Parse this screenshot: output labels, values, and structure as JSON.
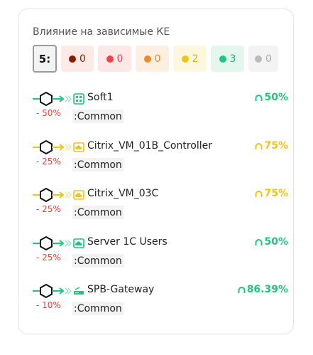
{
  "title": "Влияние на зависимые КЕ",
  "filters": {
    "total": "5:",
    "chips": [
      {
        "count": "0",
        "dot": "#8b1a00",
        "bg": "#fbeae6",
        "fg": "#8b1a00"
      },
      {
        "count": "0",
        "dot": "#ef4444",
        "bg": "#fde8e8",
        "fg": "#ef4444"
      },
      {
        "count": "0",
        "dot": "#f08a24",
        "bg": "#fdefe2",
        "fg": "#f08a24"
      },
      {
        "count": "2",
        "dot": "#f2c318",
        "bg": "#fdf7df",
        "fg": "#e0b100"
      },
      {
        "count": "3",
        "dot": "#22c47f",
        "bg": "#e3f7ee",
        "fg": "#1db273"
      },
      {
        "count": "0",
        "dot": "#bbbbbb",
        "bg": "#f3f3f3",
        "fg": "#aaaaaa"
      }
    ]
  },
  "items": [
    {
      "name": "Soft1",
      "namespace": ":Common",
      "impact": "- 50%",
      "health": "50%",
      "health_color": "#22c47f",
      "line_color": "#22c47f",
      "icon": "grid-app-icon",
      "icon_color": "#22c47f"
    },
    {
      "name": "Citrix_VM_01B_Controller",
      "namespace": ":Common",
      "impact": "- 25%",
      "health": "75%",
      "health_color": "#f2c318",
      "line_color": "#f2c318",
      "icon": "cloud-icon",
      "icon_color": "#f2c318"
    },
    {
      "name": "Citrix_VM_03C",
      "namespace": ":Common",
      "impact": "- 25%",
      "health": "75%",
      "health_color": "#f2c318",
      "line_color": "#f2c318",
      "icon": "cloud-icon",
      "icon_color": "#f2c318"
    },
    {
      "name": "Server 1C Users",
      "namespace": ":Common",
      "impact": "- 25%",
      "health": "50%",
      "health_color": "#22c47f",
      "line_color": "#22c47f",
      "icon": "cloud-icon",
      "icon_color": "#22c47f"
    },
    {
      "name": "SPB-Gateway",
      "namespace": ":Common",
      "impact": "- 10%",
      "health": "86.39%",
      "health_color": "#22c47f",
      "line_color": "#22c47f",
      "icon": "router-icon",
      "icon_color": "#22c47f"
    }
  ]
}
